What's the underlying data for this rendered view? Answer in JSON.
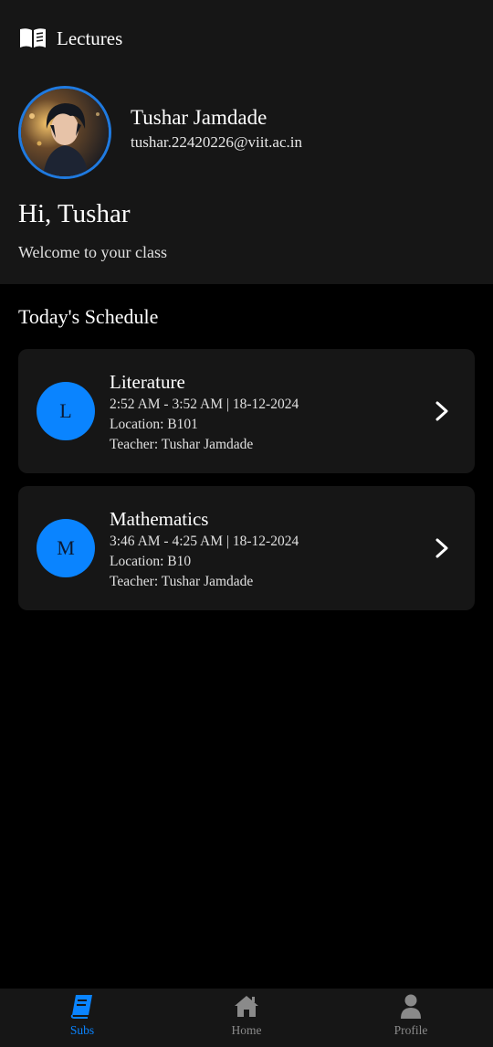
{
  "app": {
    "title": "Lectures",
    "icon": "open-book-icon"
  },
  "profile": {
    "name": "Tushar Jamdade",
    "email": "tushar.22420226@viit.ac.in",
    "avatar": "anime-style portrait avatar"
  },
  "greeting": {
    "title": "Hi, Tushar",
    "subtitle": "Welcome to your class"
  },
  "schedule": {
    "title": "Today's Schedule",
    "items": [
      {
        "initial": "L",
        "subject": "Literature",
        "time": "2:52 AM - 3:52 AM | 18-12-2024",
        "location": "Location: B101",
        "teacher": "Teacher: Tushar Jamdade",
        "icon": "chevron-right-icon"
      },
      {
        "initial": "M",
        "subject": "Mathematics",
        "time": "3:46 AM - 4:25 AM | 18-12-2024",
        "location": "Location: B10",
        "teacher": "Teacher: Tushar Jamdade",
        "icon": "chevron-right-icon"
      }
    ]
  },
  "nav": {
    "items": [
      {
        "label": "Subs",
        "icon": "book-icon",
        "active": true
      },
      {
        "label": "Home",
        "icon": "home-icon",
        "active": false
      },
      {
        "label": "Profile",
        "icon": "user-icon",
        "active": false
      }
    ]
  },
  "colors": {
    "accent": "#0a84ff",
    "background": "#000000",
    "surface": "#161616",
    "inactive": "#8a8a8a"
  }
}
